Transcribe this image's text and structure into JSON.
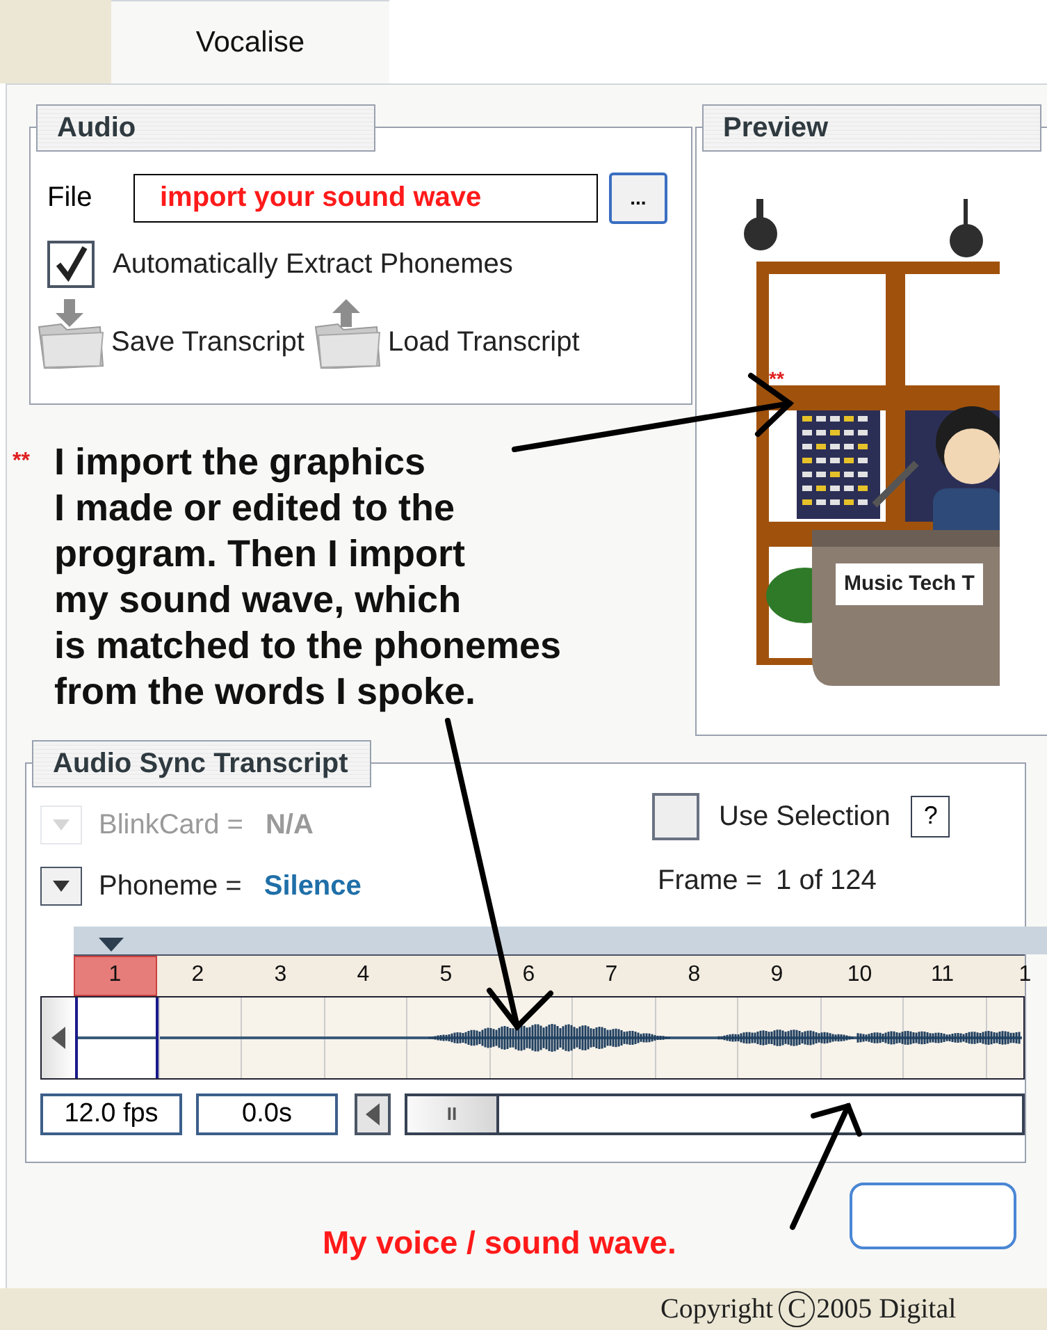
{
  "tab": {
    "label": "Vocalise",
    "selected": true
  },
  "audio": {
    "title": "Audio",
    "file_label": "File",
    "file_value": "import your sound wave",
    "browse_button": "...",
    "auto_extract": {
      "label": "Automatically Extract Phonemes",
      "checked": true
    },
    "actions": [
      {
        "label": "Save Transcript",
        "kind": "save"
      },
      {
        "label": "Load Transcript",
        "kind": "load"
      }
    ]
  },
  "preview": {
    "title": "Preview",
    "marker": "**",
    "sign": "Music Tech T"
  },
  "annotation": {
    "marker": "**",
    "lines": [
      "I import the graphics",
      "I made or edited to the",
      "program. Then I import",
      "my sound wave, which",
      "is matched to the phonemes",
      "from the words I spoke."
    ]
  },
  "sync": {
    "title": "Audio Sync Transcript",
    "fields": [
      {
        "label": "BlinkCard =",
        "value": "N/A",
        "disabled": true
      },
      {
        "label": "Phoneme =",
        "value": "Silence",
        "disabled": false
      }
    ],
    "use_selection": {
      "label": "Use Selection",
      "checked": false
    },
    "help": "?",
    "frame": {
      "label": "Frame =",
      "value": "1 of 124"
    },
    "frames": [
      {
        "label": "1",
        "selected": true
      },
      {
        "label": "2",
        "selected": false
      },
      {
        "label": "3",
        "selected": false
      },
      {
        "label": "4",
        "selected": false
      },
      {
        "label": "5",
        "selected": false
      },
      {
        "label": "6",
        "selected": false
      },
      {
        "label": "7",
        "selected": false
      },
      {
        "label": "8",
        "selected": false
      },
      {
        "label": "9",
        "selected": false
      },
      {
        "label": "10",
        "selected": false
      },
      {
        "label": "11",
        "selected": false
      },
      {
        "label": "1",
        "selected": false
      }
    ],
    "fps": "12.0 fps",
    "time": "0.0s",
    "pause": "II"
  },
  "callout": "My voice / sound wave.",
  "copyright": {
    "label": "Copyright",
    "symbol": "C",
    "rest": "2005 Digital"
  }
}
